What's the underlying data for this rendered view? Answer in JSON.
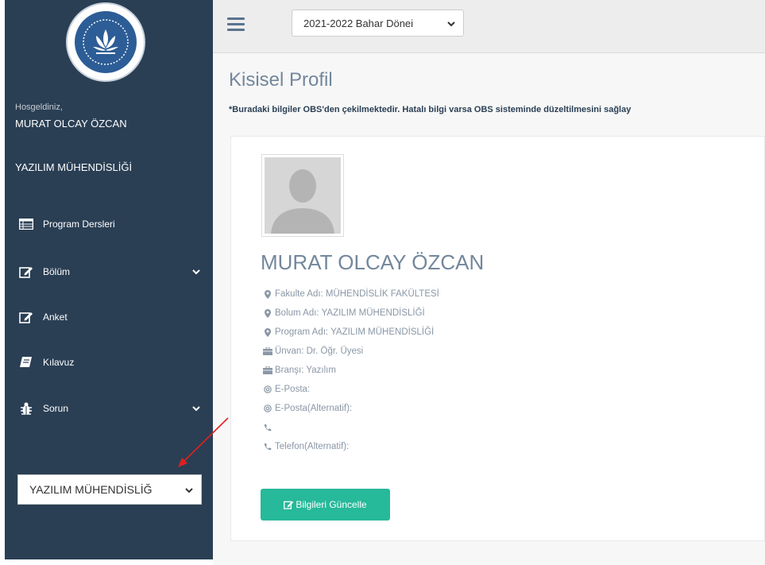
{
  "sidebar": {
    "welcome": "Hosgeldiniz,",
    "user_name": "MURAT OLCAY ÖZCAN",
    "department": "YAZILIM MÜHENDİSLİĞİ",
    "items": [
      {
        "label": "Program Dersleri",
        "icon": "table-icon",
        "has_submenu": false
      },
      {
        "label": "Bölüm",
        "icon": "edit-icon",
        "has_submenu": true
      },
      {
        "label": "Anket",
        "icon": "edit-icon",
        "has_submenu": false
      },
      {
        "label": "Kılavuz",
        "icon": "book-icon",
        "has_submenu": false
      },
      {
        "label": "Sorun",
        "icon": "bug-icon",
        "has_submenu": true
      }
    ],
    "bottom_select": {
      "value": "YAZILIM MÜHENDİSLİĞ"
    }
  },
  "topbar": {
    "term_select": {
      "value": "2021-2022 Bahar Dönei"
    }
  },
  "main": {
    "title": "Kisisel Profil",
    "notice": "*Buradaki bilgiler OBS'den çekilmektedir. Hatalı bilgi varsa OBS sisteminde düzeltilmesini sağlay",
    "profile": {
      "name": "MURAT OLCAY ÖZCAN",
      "fields": [
        {
          "icon": "map-marker-icon",
          "text": "Fakulte Adı: MÜHENDİSLİK FAKÜLTESİ"
        },
        {
          "icon": "map-marker-icon",
          "text": "Bolum Adı: YAZILIM MÜHENDİSLİĞİ"
        },
        {
          "icon": "map-marker-icon",
          "text": "Program Adı: YAZILIM MÜHENDİSLİĞİ"
        },
        {
          "icon": "briefcase-icon",
          "text": "Ünvan: Dr. Öğr. Üyesi"
        },
        {
          "icon": "briefcase-icon",
          "text": "Branşı: Yazılım"
        },
        {
          "icon": "at-icon",
          "text": "E-Posta:"
        },
        {
          "icon": "at-icon",
          "text": "E-Posta(Alternatif):"
        },
        {
          "icon": "phone-icon",
          "text": ""
        },
        {
          "icon": "phone-icon",
          "text": "Telefon(Alternatif):"
        }
      ],
      "update_button": "Bilgileri Güncelle"
    }
  },
  "colors": {
    "sidebar_bg": "#2a3f54",
    "button_green": "#26b99a",
    "title_color": "#73879c",
    "annotation_arrow": "#e02020"
  }
}
